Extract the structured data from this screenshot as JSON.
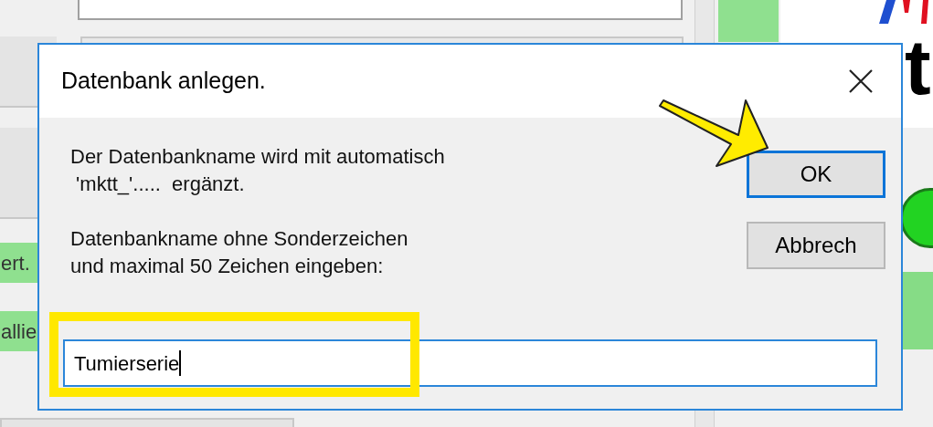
{
  "background": {
    "labels": [
      {
        "text": "ert."
      },
      {
        "text": "allie"
      }
    ],
    "heading_fragment": "t"
  },
  "dialog": {
    "title": "Datenbank anlegen.",
    "paragraphs": [
      {
        "lines": [
          "Der Datenbankname wird mit automatisch",
          " 'mktt_'.....  ergänzt."
        ]
      },
      {
        "lines": [
          "Datenbankname ohne Sonderzeichen",
          "und maximal 50 Zeichen eingeben:"
        ]
      }
    ],
    "input": {
      "value": "Tumierserie",
      "focused": true
    },
    "buttons": [
      {
        "label": "OK",
        "default": true
      },
      {
        "label": "Abbrech",
        "default": false
      }
    ]
  }
}
